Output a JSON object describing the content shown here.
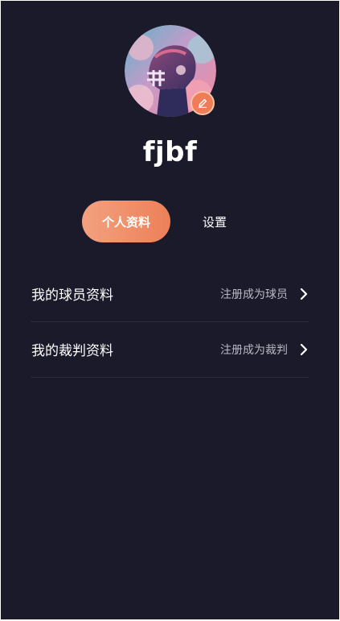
{
  "profile": {
    "username": "fjbf"
  },
  "tabs": [
    {
      "label": "个人资料",
      "active": true
    },
    {
      "label": "设置",
      "active": false
    }
  ],
  "rows": [
    {
      "title": "我的球员资料",
      "action": "注册成为球员"
    },
    {
      "title": "我的裁判资料",
      "action": "注册成为裁判"
    }
  ],
  "colors": {
    "background": "#1b1a2b",
    "accent": "#ec8058",
    "accent_light": "#f3a17f",
    "divider": "#2e2d3e",
    "secondary_text": "#b9b8c4"
  },
  "icons": {
    "avatar": "football-helmet-avatar",
    "edit": "pencil-icon",
    "chevron": "chevron-right-icon"
  }
}
